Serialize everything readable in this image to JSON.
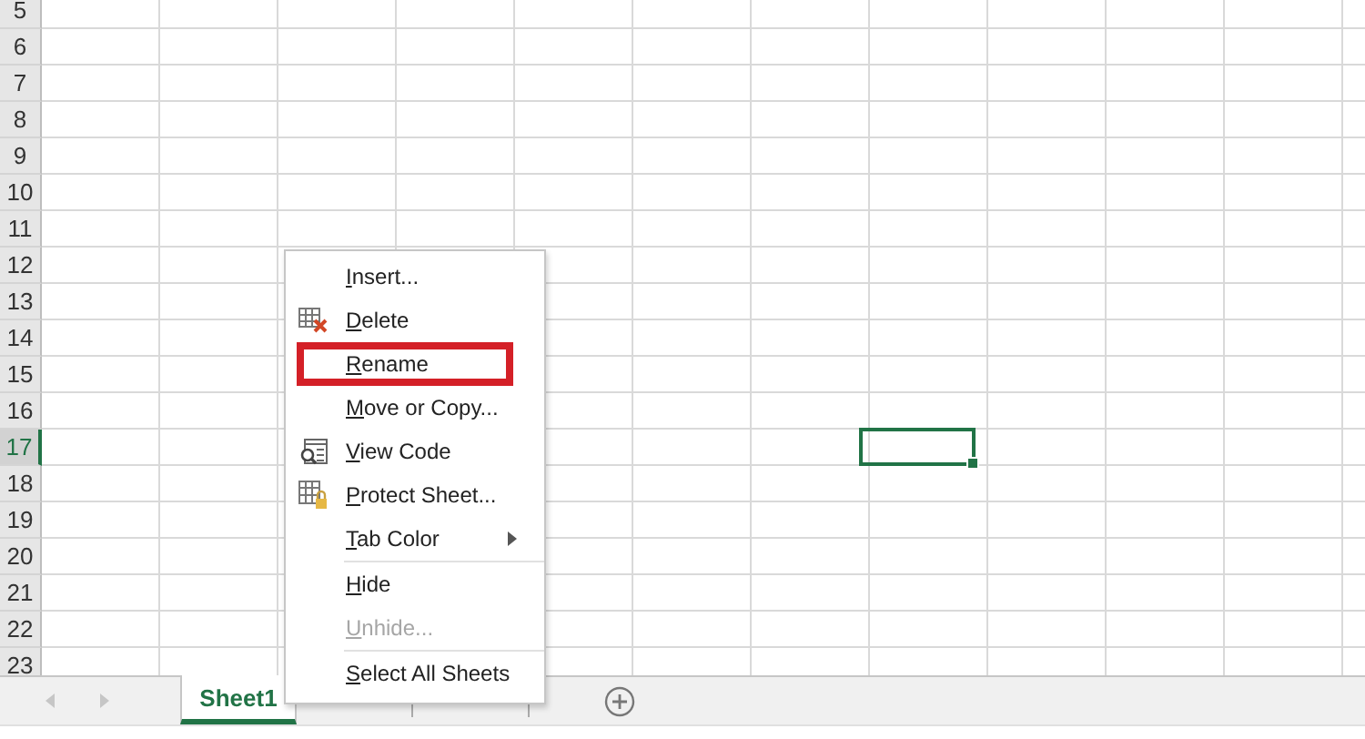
{
  "rows": [
    {
      "label": "5",
      "selected": false
    },
    {
      "label": "6",
      "selected": false
    },
    {
      "label": "7",
      "selected": false
    },
    {
      "label": "8",
      "selected": false
    },
    {
      "label": "9",
      "selected": false
    },
    {
      "label": "10",
      "selected": false
    },
    {
      "label": "11",
      "selected": false
    },
    {
      "label": "12",
      "selected": false
    },
    {
      "label": "13",
      "selected": false
    },
    {
      "label": "14",
      "selected": false
    },
    {
      "label": "15",
      "selected": false
    },
    {
      "label": "16",
      "selected": false
    },
    {
      "label": "17",
      "selected": true
    },
    {
      "label": "18",
      "selected": false
    },
    {
      "label": "19",
      "selected": false
    },
    {
      "label": "20",
      "selected": false
    },
    {
      "label": "21",
      "selected": false
    },
    {
      "label": "22",
      "selected": false
    },
    {
      "label": "23",
      "selected": false
    }
  ],
  "sheet_tabs": [
    {
      "label": "Sheet1",
      "selected": true
    },
    {
      "selected": false
    },
    {
      "selected": false
    }
  ],
  "context_menu": {
    "items": [
      {
        "kind": "item",
        "label": "Insert...",
        "disabled": false,
        "highlighted": false
      },
      {
        "kind": "delete",
        "label": "Delete",
        "disabled": false,
        "highlighted": false
      },
      {
        "kind": "item",
        "label": "Rename",
        "disabled": false,
        "highlighted": true
      },
      {
        "kind": "item",
        "label": "Move or Copy...",
        "disabled": false,
        "highlighted": false
      },
      {
        "kind": "code",
        "label": "View Code",
        "disabled": false,
        "highlighted": false
      },
      {
        "kind": "protect",
        "label": "Protect Sheet...",
        "disabled": false,
        "highlighted": false
      },
      {
        "kind": "submenu",
        "label": "Tab Color",
        "disabled": false,
        "highlighted": false
      },
      {
        "kind": "separator"
      },
      {
        "kind": "item",
        "label": "Hide",
        "disabled": false,
        "highlighted": false
      },
      {
        "kind": "item",
        "label": "Unhide...",
        "disabled": true,
        "highlighted": false
      },
      {
        "kind": "separator"
      },
      {
        "kind": "item",
        "label": "Select All Sheets",
        "disabled": false,
        "highlighted": false
      }
    ]
  }
}
